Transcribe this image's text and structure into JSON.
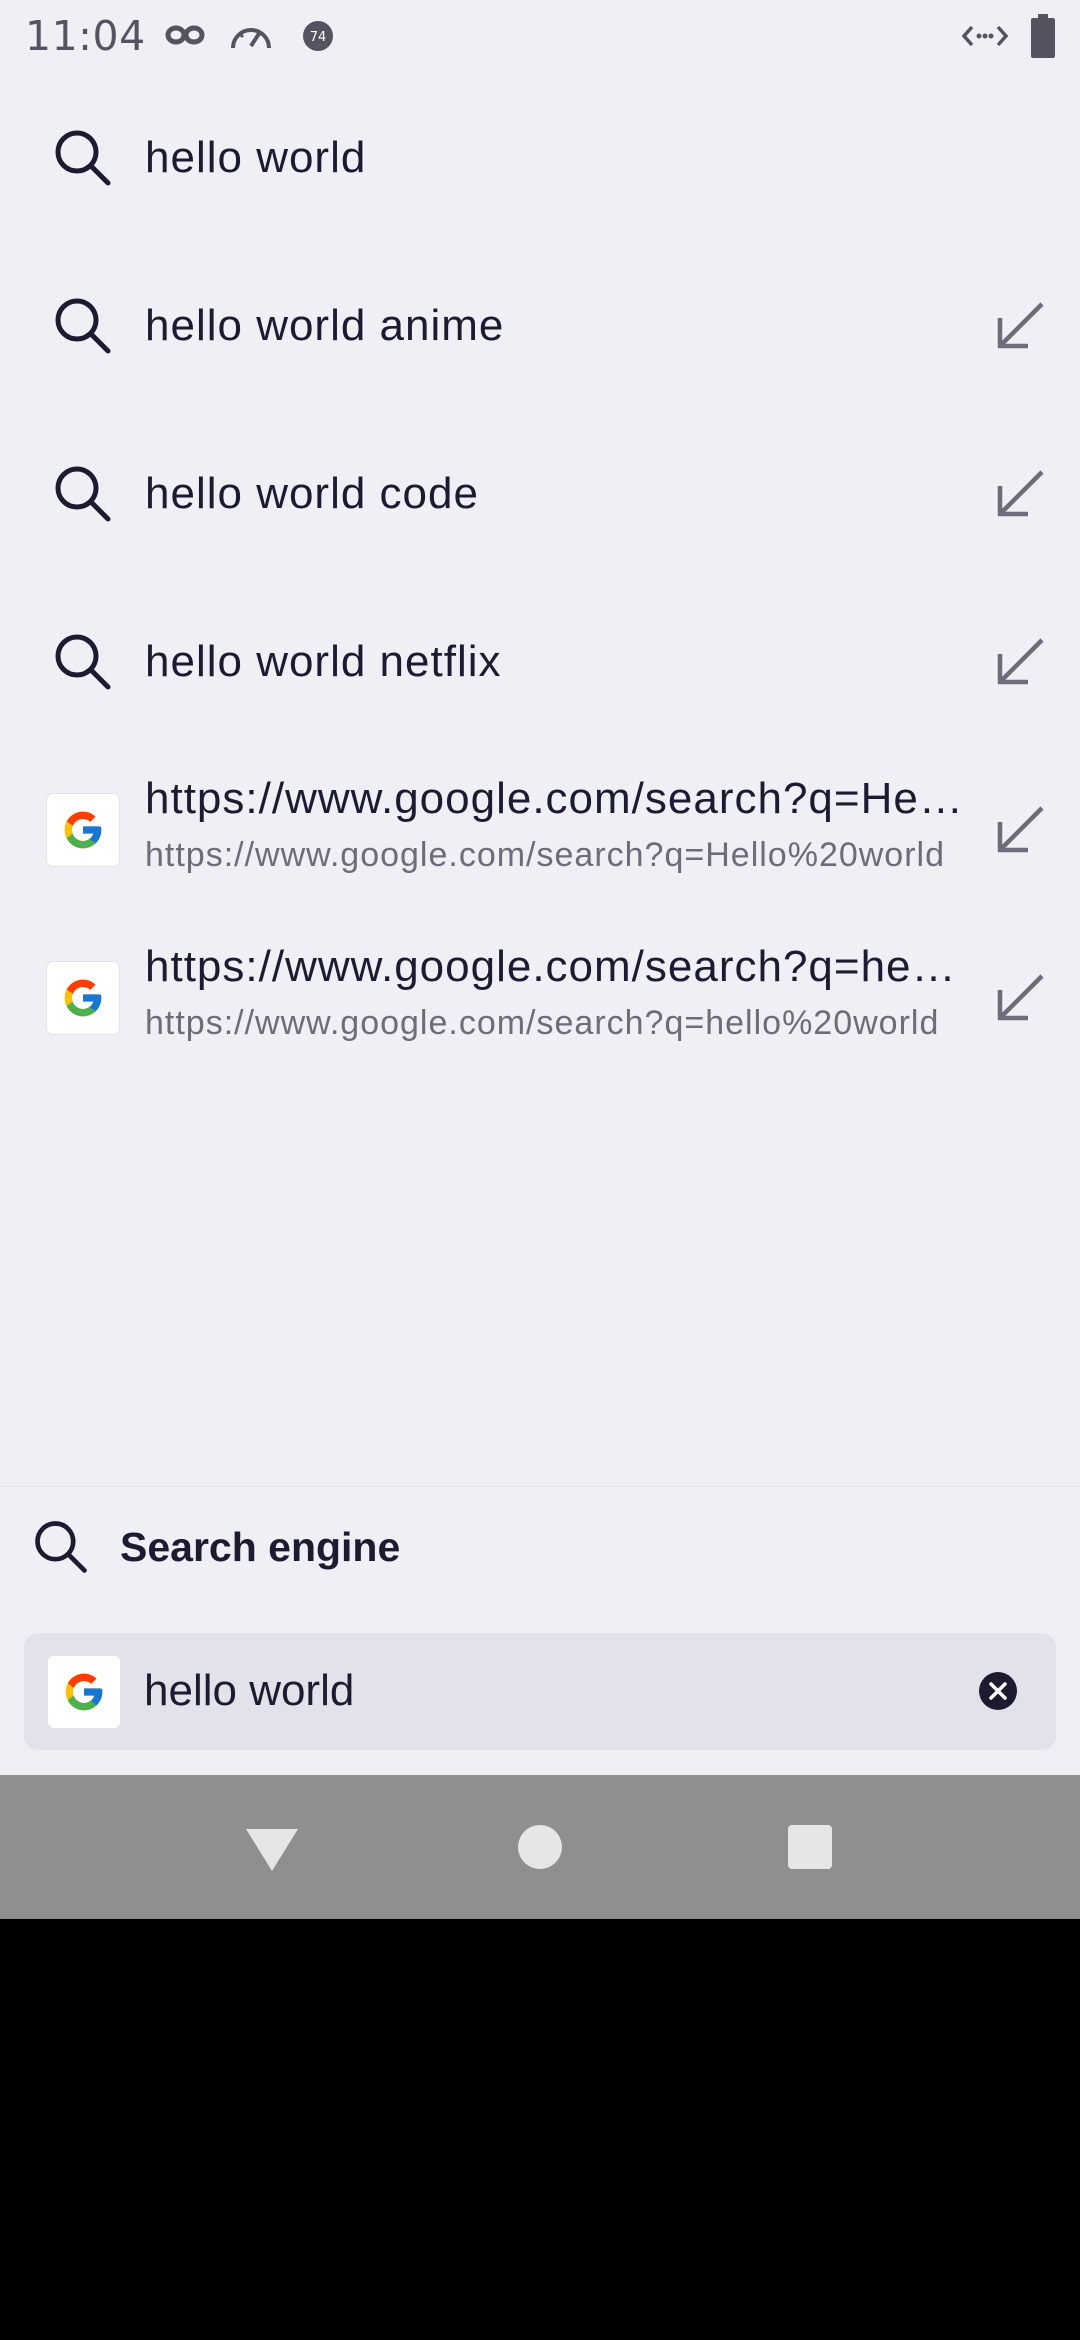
{
  "status_bar": {
    "time": "11:04",
    "badge": "74",
    "icons": [
      "incognito-icon",
      "speedometer-icon",
      "notification-badge-icon",
      "code-arrows-icon",
      "battery-icon"
    ]
  },
  "suggestions": [
    {
      "text": "hello world",
      "icon": "search-icon",
      "has_arrow": false
    },
    {
      "text": "hello world anime",
      "icon": "search-icon",
      "has_arrow": true
    },
    {
      "text": "hello world code",
      "icon": "search-icon",
      "has_arrow": true
    },
    {
      "text": "hello world netflix",
      "icon": "search-icon",
      "has_arrow": true
    }
  ],
  "url_suggestions": [
    {
      "title": "https://www.google.com/search?q=Hello%20world",
      "url": "https://www.google.com/search?q=Hello%20world",
      "icon": "google-icon"
    },
    {
      "title": "https://www.google.com/search?q=hello%20world",
      "url": "https://www.google.com/search?q=hello%20world",
      "icon": "google-icon"
    }
  ],
  "search_engine": {
    "label": "Search engine",
    "icon": "search-icon"
  },
  "address_bar": {
    "value": "hello world",
    "engine_icon": "google-icon",
    "clear_icon": "clear-icon"
  },
  "nav": {
    "icons": [
      "back-icon",
      "home-icon",
      "recents-icon"
    ]
  },
  "colors": {
    "background": "#f0eff5",
    "text": "#1d1b30",
    "secondary_text": "#6e6c78",
    "address_bar": "#e3e2ea",
    "nav_bar": "#8f8f8f"
  }
}
